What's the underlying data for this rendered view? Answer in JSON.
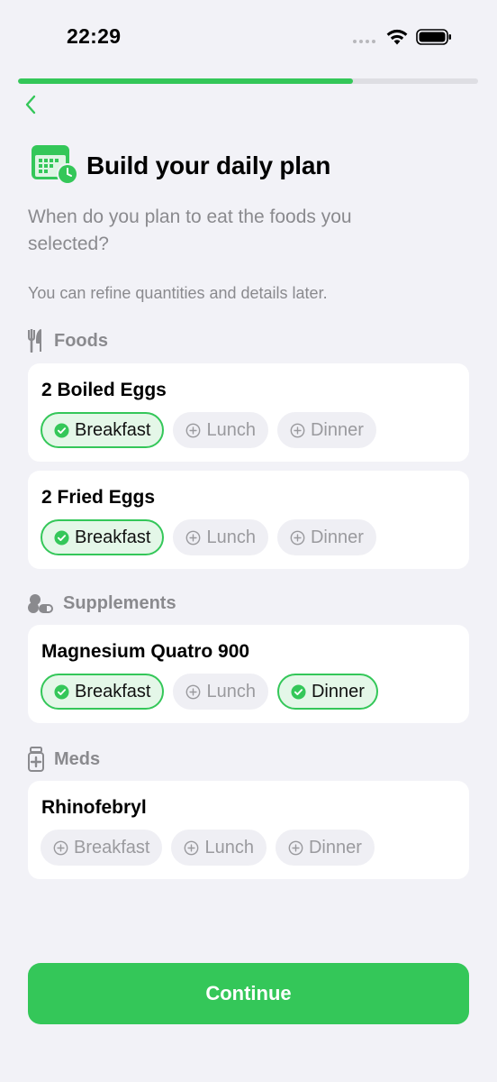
{
  "status_bar": {
    "time": "22:29"
  },
  "progress": {
    "fraction": 0.728
  },
  "header": {
    "title": "Build your daily plan",
    "subtitle": "When do you plan to eat the foods you selected?",
    "hint": "You can refine quantities and details later."
  },
  "sections": {
    "foods": {
      "label": "Foods",
      "items": [
        {
          "name": "2 Boiled Eggs",
          "meals": [
            {
              "label": "Breakfast",
              "selected": true
            },
            {
              "label": "Lunch",
              "selected": false
            },
            {
              "label": "Dinner",
              "selected": false
            }
          ]
        },
        {
          "name": "2 Fried Eggs",
          "meals": [
            {
              "label": "Breakfast",
              "selected": true
            },
            {
              "label": "Lunch",
              "selected": false
            },
            {
              "label": "Dinner",
              "selected": false
            }
          ]
        }
      ]
    },
    "supplements": {
      "label": "Supplements",
      "items": [
        {
          "name": "Magnesium Quatro 900",
          "meals": [
            {
              "label": "Breakfast",
              "selected": true
            },
            {
              "label": "Lunch",
              "selected": false
            },
            {
              "label": "Dinner",
              "selected": true
            }
          ]
        }
      ]
    },
    "meds": {
      "label": "Meds",
      "items": [
        {
          "name": "Rhinofebryl",
          "meals": [
            {
              "label": "Breakfast",
              "selected": false
            },
            {
              "label": "Lunch",
              "selected": false
            },
            {
              "label": "Dinner",
              "selected": false
            }
          ]
        }
      ]
    }
  },
  "continue_label": "Continue",
  "colors": {
    "accent": "#34c759",
    "background": "#f2f2f7",
    "muted": "#8a8a8e"
  }
}
